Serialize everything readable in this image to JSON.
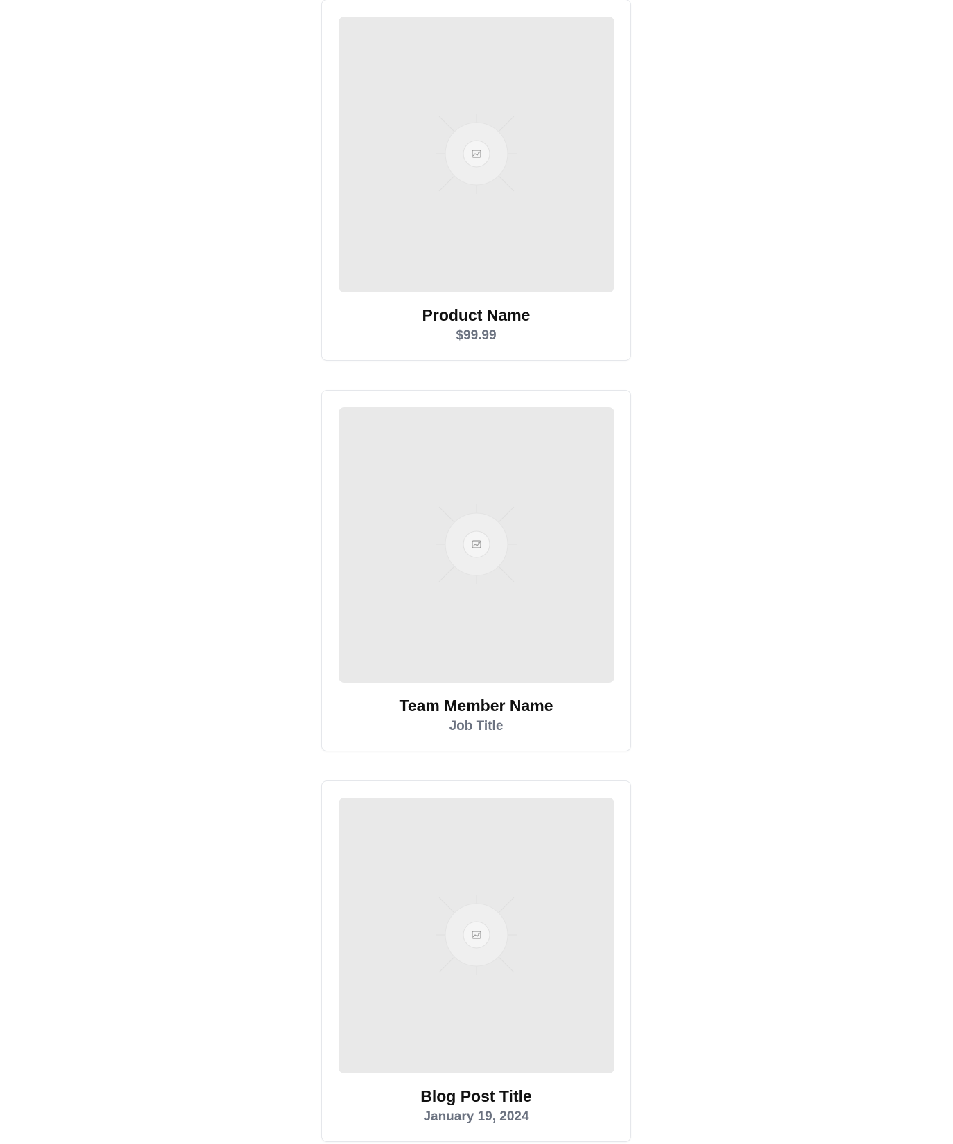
{
  "cards": [
    {
      "title": "Product Name",
      "subtitle": "$99.99",
      "image_icon": "image-placeholder-icon"
    },
    {
      "title": "Team Member Name",
      "subtitle": "Job Title",
      "image_icon": "image-placeholder-icon"
    },
    {
      "title": "Blog Post Title",
      "subtitle": "January 19, 2024",
      "image_icon": "image-placeholder-icon"
    }
  ],
  "colors": {
    "placeholder_bg": "#e9e9e9",
    "title": "#111111",
    "subtitle": "#6b7280",
    "border": "#e5e7eb"
  }
}
